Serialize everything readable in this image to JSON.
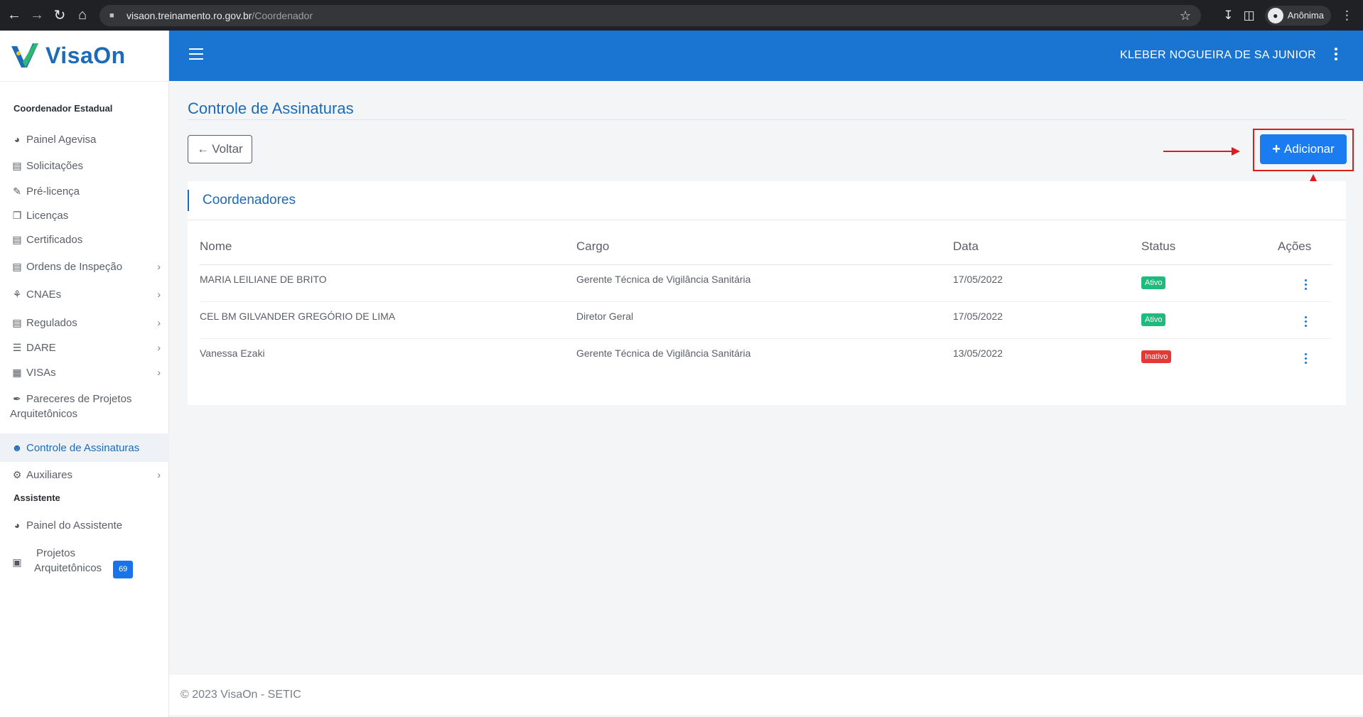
{
  "browser": {
    "url_host": "visaon.treinamento.ro.gov.br",
    "url_path": "/Coordenador",
    "profile_label": "Anônima"
  },
  "app": {
    "logo_text": "VisaOn",
    "user_name": "KLEBER NOGUEIRA DE SA JUNIOR"
  },
  "sidebar": {
    "section1": "Coordenador Estadual",
    "items": [
      {
        "label": "Painel Agevisa",
        "icon": "dashboard-icon"
      },
      {
        "label": "Solicitações",
        "icon": "clipboard-icon"
      },
      {
        "label": "Pré-licença",
        "icon": "edit-doc-icon"
      },
      {
        "label": "Licenças",
        "icon": "copy-icon"
      },
      {
        "label": "Certificados",
        "icon": "certificate-icon"
      },
      {
        "label": "Ordens de Inspeção",
        "icon": "document-icon"
      },
      {
        "label": "CNAEs",
        "icon": "sitemap-icon"
      },
      {
        "label": "Regulados",
        "icon": "file-icon"
      },
      {
        "label": "DARE",
        "icon": "barcode-icon"
      },
      {
        "label": "VISAs",
        "icon": "building-icon"
      },
      {
        "label": "Pareceres de Projetos",
        "label2": "Arquitetônicos",
        "icon": "feather-icon"
      },
      {
        "label": "Controle de Assinaturas",
        "icon": "users-icon"
      },
      {
        "label": "Auxiliares",
        "icon": "gears-icon"
      }
    ],
    "section2": "Assistente",
    "items2": [
      {
        "label": "Painel do Assistente",
        "icon": "dashboard-icon"
      },
      {
        "label": "Projetos",
        "label2": "Arquitetônicos",
        "badge": "69",
        "icon": "blueprint-icon"
      }
    ]
  },
  "page": {
    "title": "Controle de Assinaturas",
    "back_label": "Voltar",
    "add_label": "Adicionar",
    "card_title": "Coordenadores"
  },
  "table": {
    "headers": [
      "Nome",
      "Cargo",
      "Data",
      "Status",
      "Ações"
    ],
    "rows": [
      {
        "nome": "MARIA LEILIANE DE BRITO",
        "cargo": "Gerente Técnica de Vigilância Sanitária",
        "data": "17/05/2022",
        "status": "Ativo"
      },
      {
        "nome": "CEL BM GILVANDER GREGÓRIO DE LIMA",
        "cargo": "Diretor Geral",
        "data": "17/05/2022",
        "status": "Ativo"
      },
      {
        "nome": "Vanessa Ezaki",
        "cargo": "Gerente Técnica de Vigilância Sanitária",
        "data": "13/05/2022",
        "status": "Inativo"
      }
    ]
  },
  "footer": {
    "text": "© 2023 VisaOn - SETIC"
  },
  "colors": {
    "primary": "#1a74d2",
    "accent": "#1a7cf0",
    "active": "#1ebc7c",
    "inactive": "#e53935",
    "annotation": "#e01b1b"
  }
}
